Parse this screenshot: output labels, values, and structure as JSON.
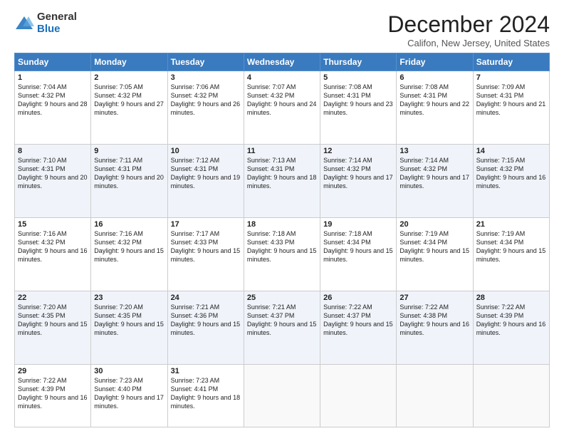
{
  "header": {
    "logo_general": "General",
    "logo_blue": "Blue",
    "title": "December 2024",
    "location": "Califon, New Jersey, United States"
  },
  "days_of_week": [
    "Sunday",
    "Monday",
    "Tuesday",
    "Wednesday",
    "Thursday",
    "Friday",
    "Saturday"
  ],
  "weeks": [
    [
      {
        "day": "1",
        "sunrise": "7:04 AM",
        "sunset": "4:32 PM",
        "daylight": "9 hours and 28 minutes."
      },
      {
        "day": "2",
        "sunrise": "7:05 AM",
        "sunset": "4:32 PM",
        "daylight": "9 hours and 27 minutes."
      },
      {
        "day": "3",
        "sunrise": "7:06 AM",
        "sunset": "4:32 PM",
        "daylight": "9 hours and 26 minutes."
      },
      {
        "day": "4",
        "sunrise": "7:07 AM",
        "sunset": "4:32 PM",
        "daylight": "9 hours and 24 minutes."
      },
      {
        "day": "5",
        "sunrise": "7:08 AM",
        "sunset": "4:31 PM",
        "daylight": "9 hours and 23 minutes."
      },
      {
        "day": "6",
        "sunrise": "7:08 AM",
        "sunset": "4:31 PM",
        "daylight": "9 hours and 22 minutes."
      },
      {
        "day": "7",
        "sunrise": "7:09 AM",
        "sunset": "4:31 PM",
        "daylight": "9 hours and 21 minutes."
      }
    ],
    [
      {
        "day": "8",
        "sunrise": "7:10 AM",
        "sunset": "4:31 PM",
        "daylight": "9 hours and 20 minutes."
      },
      {
        "day": "9",
        "sunrise": "7:11 AM",
        "sunset": "4:31 PM",
        "daylight": "9 hours and 20 minutes."
      },
      {
        "day": "10",
        "sunrise": "7:12 AM",
        "sunset": "4:31 PM",
        "daylight": "9 hours and 19 minutes."
      },
      {
        "day": "11",
        "sunrise": "7:13 AM",
        "sunset": "4:31 PM",
        "daylight": "9 hours and 18 minutes."
      },
      {
        "day": "12",
        "sunrise": "7:14 AM",
        "sunset": "4:32 PM",
        "daylight": "9 hours and 17 minutes."
      },
      {
        "day": "13",
        "sunrise": "7:14 AM",
        "sunset": "4:32 PM",
        "daylight": "9 hours and 17 minutes."
      },
      {
        "day": "14",
        "sunrise": "7:15 AM",
        "sunset": "4:32 PM",
        "daylight": "9 hours and 16 minutes."
      }
    ],
    [
      {
        "day": "15",
        "sunrise": "7:16 AM",
        "sunset": "4:32 PM",
        "daylight": "9 hours and 16 minutes."
      },
      {
        "day": "16",
        "sunrise": "7:16 AM",
        "sunset": "4:32 PM",
        "daylight": "9 hours and 15 minutes."
      },
      {
        "day": "17",
        "sunrise": "7:17 AM",
        "sunset": "4:33 PM",
        "daylight": "9 hours and 15 minutes."
      },
      {
        "day": "18",
        "sunrise": "7:18 AM",
        "sunset": "4:33 PM",
        "daylight": "9 hours and 15 minutes."
      },
      {
        "day": "19",
        "sunrise": "7:18 AM",
        "sunset": "4:34 PM",
        "daylight": "9 hours and 15 minutes."
      },
      {
        "day": "20",
        "sunrise": "7:19 AM",
        "sunset": "4:34 PM",
        "daylight": "9 hours and 15 minutes."
      },
      {
        "day": "21",
        "sunrise": "7:19 AM",
        "sunset": "4:34 PM",
        "daylight": "9 hours and 15 minutes."
      }
    ],
    [
      {
        "day": "22",
        "sunrise": "7:20 AM",
        "sunset": "4:35 PM",
        "daylight": "9 hours and 15 minutes."
      },
      {
        "day": "23",
        "sunrise": "7:20 AM",
        "sunset": "4:35 PM",
        "daylight": "9 hours and 15 minutes."
      },
      {
        "day": "24",
        "sunrise": "7:21 AM",
        "sunset": "4:36 PM",
        "daylight": "9 hours and 15 minutes."
      },
      {
        "day": "25",
        "sunrise": "7:21 AM",
        "sunset": "4:37 PM",
        "daylight": "9 hours and 15 minutes."
      },
      {
        "day": "26",
        "sunrise": "7:22 AM",
        "sunset": "4:37 PM",
        "daylight": "9 hours and 15 minutes."
      },
      {
        "day": "27",
        "sunrise": "7:22 AM",
        "sunset": "4:38 PM",
        "daylight": "9 hours and 16 minutes."
      },
      {
        "day": "28",
        "sunrise": "7:22 AM",
        "sunset": "4:39 PM",
        "daylight": "9 hours and 16 minutes."
      }
    ],
    [
      {
        "day": "29",
        "sunrise": "7:22 AM",
        "sunset": "4:39 PM",
        "daylight": "9 hours and 16 minutes."
      },
      {
        "day": "30",
        "sunrise": "7:23 AM",
        "sunset": "4:40 PM",
        "daylight": "9 hours and 17 minutes."
      },
      {
        "day": "31",
        "sunrise": "7:23 AM",
        "sunset": "4:41 PM",
        "daylight": "9 hours and 18 minutes."
      },
      null,
      null,
      null,
      null
    ]
  ],
  "labels": {
    "sunrise": "Sunrise:",
    "sunset": "Sunset:",
    "daylight": "Daylight:"
  }
}
